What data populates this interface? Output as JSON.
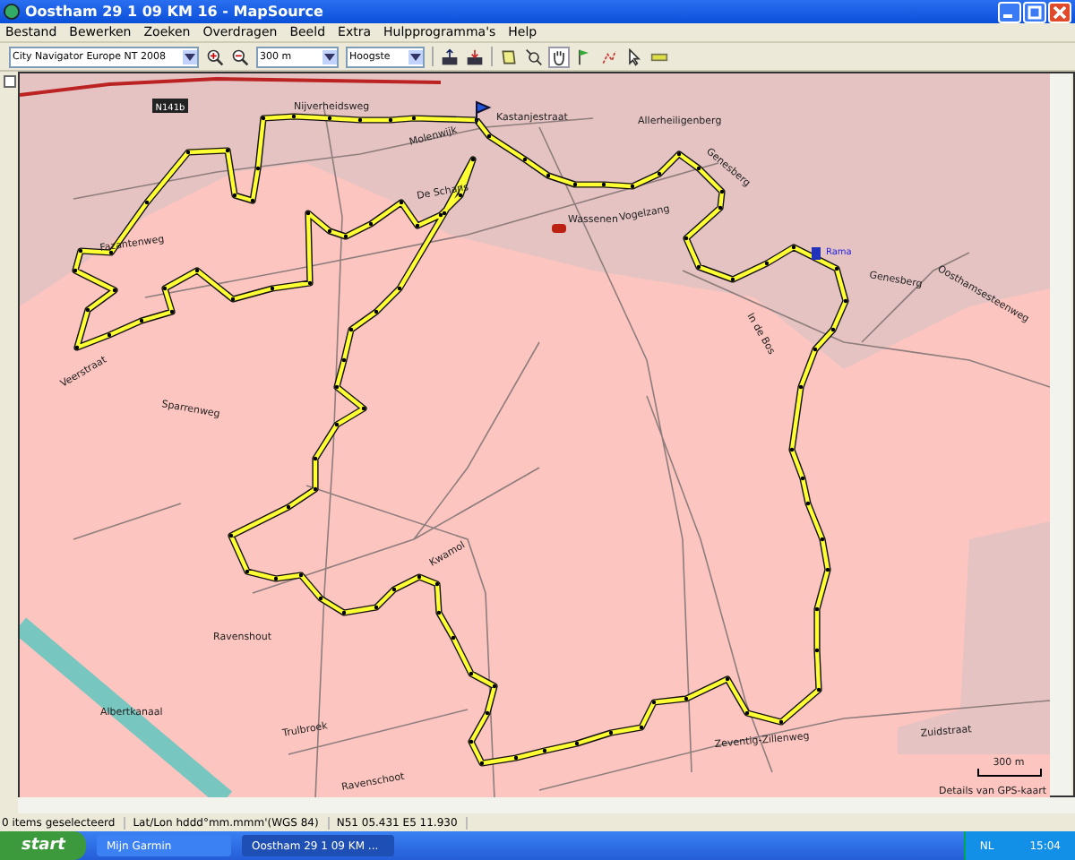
{
  "window": {
    "title": "Oostham 29 1 09 KM 16 - MapSource"
  },
  "menu": [
    "Bestand",
    "Bewerken",
    "Zoeken",
    "Overdragen",
    "Beeld",
    "Extra",
    "Hulpprogramma's",
    "Help"
  ],
  "toolbar": {
    "map_product": "City Navigator Europe NT 2008",
    "zoom_level": "300 m",
    "detail": "Hoogste"
  },
  "map": {
    "labels": [
      {
        "text": "Nijverheidsweg"
      },
      {
        "text": "Molenwijk"
      },
      {
        "text": "De Schans"
      },
      {
        "text": "Kastanjestraat"
      },
      {
        "text": "Allerheiligenberg"
      },
      {
        "text": "Genesberg"
      },
      {
        "text": "Vogelzang"
      },
      {
        "text": "Genesberg"
      },
      {
        "text": "Oosthamsesteenweg"
      },
      {
        "text": "Fazantenweg"
      },
      {
        "text": "Sparrenweg"
      },
      {
        "text": "Kwamol"
      },
      {
        "text": "Ravenshout"
      },
      {
        "text": "Albertkanaal"
      },
      {
        "text": "Trulbroek"
      },
      {
        "text": "Ravenschoot"
      },
      {
        "text": "Zeventig-Zillenweg"
      },
      {
        "text": "Zuidstraat"
      },
      {
        "text": "Wassenen"
      },
      {
        "text": "In de Bos"
      },
      {
        "text": "Veerstraat"
      }
    ],
    "road_badge": "N141b",
    "waypoint": "Rama",
    "scale": "300 m",
    "detail_note": "Details van GPS-kaart"
  },
  "status_bar": [
    "0 items geselecteerd",
    "Lat/Lon hddd°mm.mmm'(WGS 84)",
    "N51 05.431 E5 11.930"
  ],
  "taskbar": {
    "start": "start",
    "tasks": [
      {
        "label": "Mijn Garmin",
        "selected": false
      },
      {
        "label": "Oostham 29 1 09 KM ...",
        "selected": true
      }
    ],
    "language": "NL",
    "clock": "15:04"
  }
}
